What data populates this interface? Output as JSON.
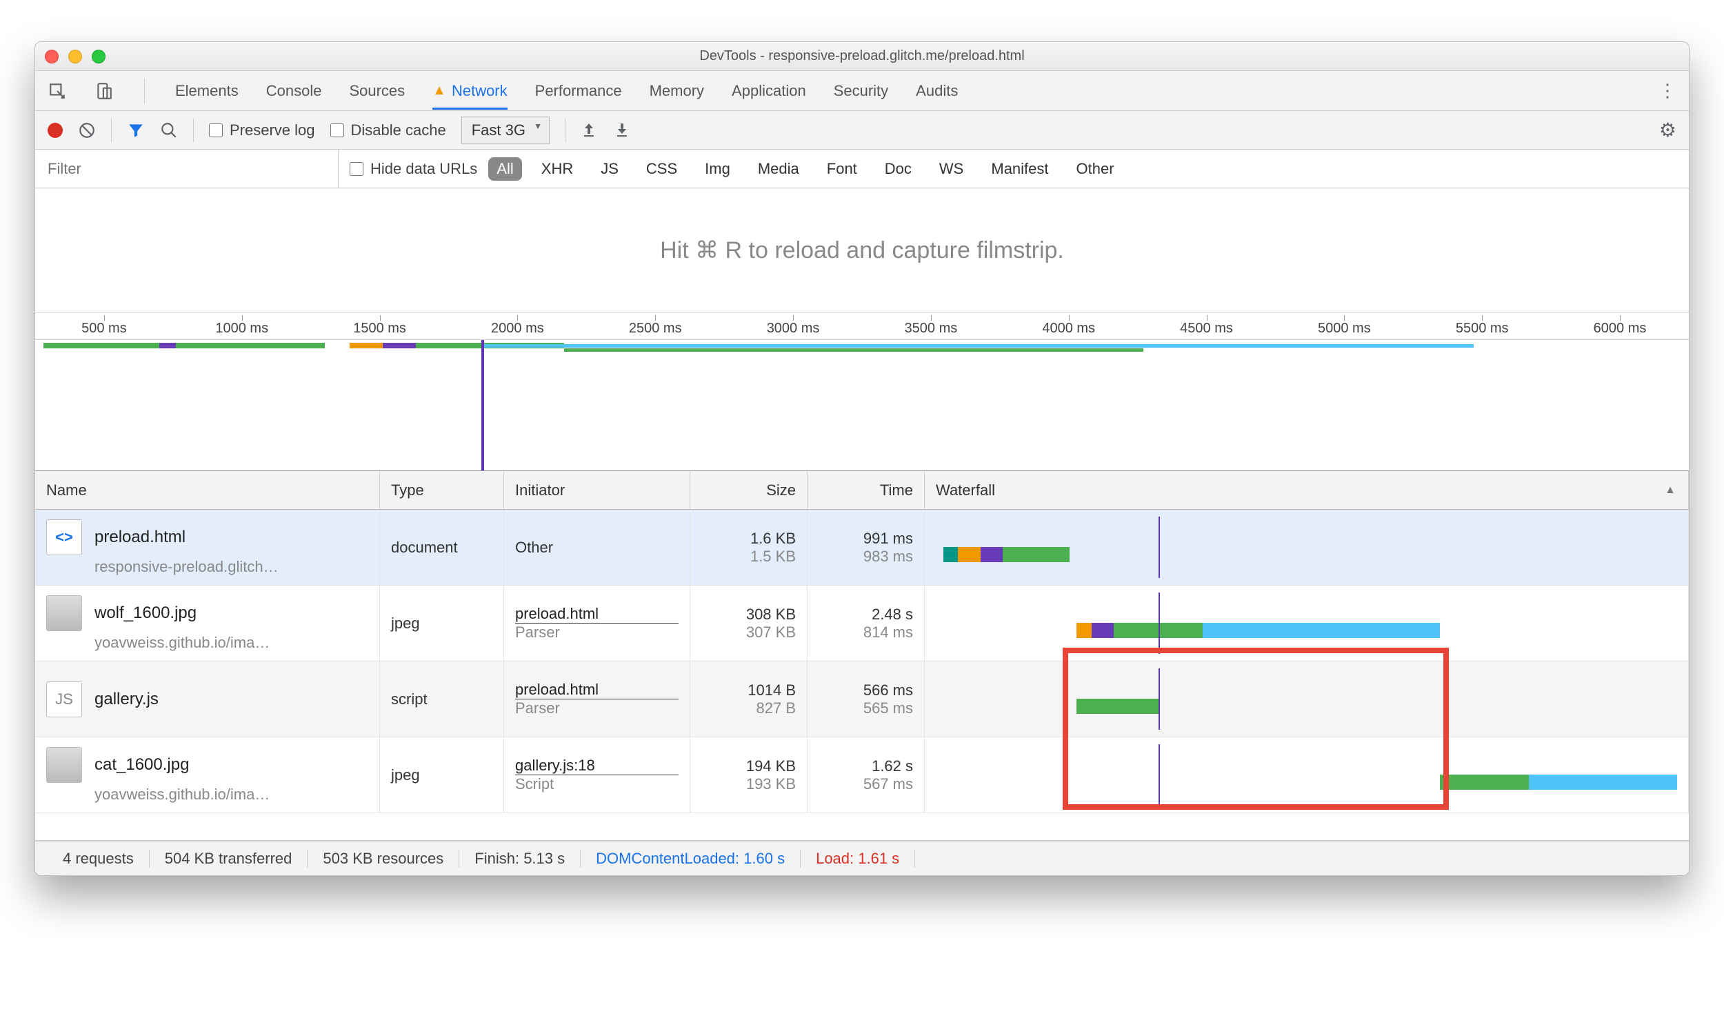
{
  "window_title": "DevTools - responsive-preload.glitch.me/preload.html",
  "tabs": [
    "Elements",
    "Console",
    "Sources",
    "Network",
    "Performance",
    "Memory",
    "Application",
    "Security",
    "Audits"
  ],
  "active_tab": "Network",
  "toolbar": {
    "preserve_log": "Preserve log",
    "disable_cache": "Disable cache",
    "throttling": "Fast 3G"
  },
  "filter": {
    "placeholder": "Filter",
    "hide_data_urls": "Hide data URLs",
    "types": [
      "All",
      "XHR",
      "JS",
      "CSS",
      "Img",
      "Media",
      "Font",
      "Doc",
      "WS",
      "Manifest",
      "Other"
    ],
    "active_type": "All"
  },
  "filmstrip_hint": "Hit ⌘ R to reload and capture filmstrip.",
  "overview_ticks": [
    "500 ms",
    "1000 ms",
    "1500 ms",
    "2000 ms",
    "2500 ms",
    "3000 ms",
    "3500 ms",
    "4000 ms",
    "4500 ms",
    "5000 ms",
    "5500 ms",
    "6000 ms"
  ],
  "columns": {
    "name": "Name",
    "type": "Type",
    "initiator": "Initiator",
    "size": "Size",
    "time": "Time",
    "waterfall": "Waterfall"
  },
  "rows": [
    {
      "name": "preload.html",
      "sub": "responsive-preload.glitch…",
      "type": "document",
      "initiator": "Other",
      "initiator_sub": "",
      "size": "1.6 KB",
      "size_sub": "1.5 KB",
      "time": "991 ms",
      "time_sub": "983 ms",
      "icon": "doc",
      "icontext": "<>"
    },
    {
      "name": "wolf_1600.jpg",
      "sub": "yoavweiss.github.io/ima…",
      "type": "jpeg",
      "initiator": "preload.html",
      "initiator_sub": "Parser",
      "size": "308 KB",
      "size_sub": "307 KB",
      "time": "2.48 s",
      "time_sub": "814 ms",
      "icon": "img",
      "icontext": ""
    },
    {
      "name": "gallery.js",
      "sub": "",
      "type": "script",
      "initiator": "preload.html",
      "initiator_sub": "Parser",
      "size": "1014 B",
      "size_sub": "827 B",
      "time": "566 ms",
      "time_sub": "565 ms",
      "icon": "js",
      "icontext": "JS"
    },
    {
      "name": "cat_1600.jpg",
      "sub": "yoavweiss.github.io/ima…",
      "type": "jpeg",
      "initiator": "gallery.js:18",
      "initiator_sub": "Script",
      "size": "194 KB",
      "size_sub": "193 KB",
      "time": "1.62 s",
      "time_sub": "567 ms",
      "icon": "img",
      "icontext": ""
    }
  ],
  "status": {
    "requests": "4 requests",
    "transferred": "504 KB transferred",
    "resources": "503 KB resources",
    "finish": "Finish: 5.13 s",
    "dcl": "DOMContentLoaded: 1.60 s",
    "load": "Load: 1.61 s"
  }
}
